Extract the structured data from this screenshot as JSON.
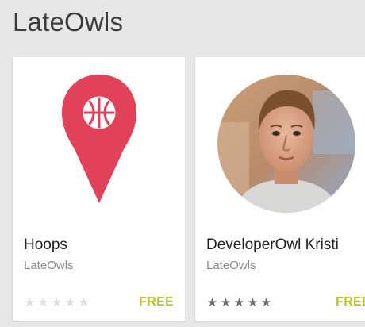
{
  "developer": {
    "title": "LateOwls"
  },
  "apps": [
    {
      "name": "Hoops",
      "developer": "LateOwls",
      "price": "FREE",
      "rating_stars": 0,
      "icon": "basketball-map-pin-icon",
      "accent": "#e2415a"
    },
    {
      "name": "DeveloperOwl Kristi",
      "developer": "LateOwls",
      "price": "FREE",
      "rating_stars": 5,
      "icon": "developer-portrait-avatar"
    }
  ],
  "colors": {
    "background": "#e7e7e7",
    "card": "#ffffff",
    "price": "#b5c233",
    "pin": "#e2415a"
  }
}
